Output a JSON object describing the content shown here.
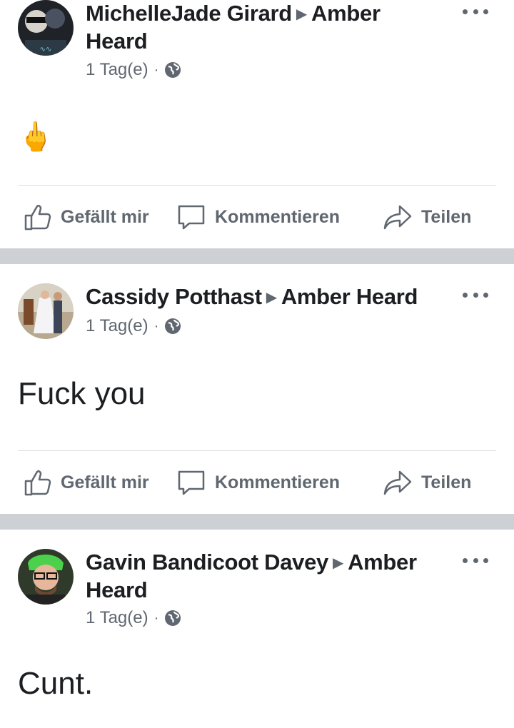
{
  "posts": [
    {
      "author": "MichelleJade Girard",
      "target": "Amber Heard",
      "time": "1 Tag(e)",
      "content": "🖕",
      "actions": {
        "like": "Gefällt mir",
        "comment": "Kommentieren",
        "share": "Teilen"
      }
    },
    {
      "author": "Cassidy Potthast",
      "target": "Amber Heard",
      "time": "1 Tag(e)",
      "content": "Fuck you",
      "actions": {
        "like": "Gefällt mir",
        "comment": "Kommentieren",
        "share": "Teilen"
      }
    },
    {
      "author": "Gavin Bandicoot Davey",
      "target": "Amber Heard",
      "time": "1 Tag(e)",
      "content": "Cunt."
    }
  ],
  "icons": {
    "privacy": "globe-icon",
    "more": "more-options-icon",
    "like": "thumbs-up-icon",
    "comment": "comment-bubble-icon",
    "share": "share-arrow-icon"
  },
  "colors": {
    "secondary_text": "#606770",
    "separator": "#cdd0d4"
  }
}
